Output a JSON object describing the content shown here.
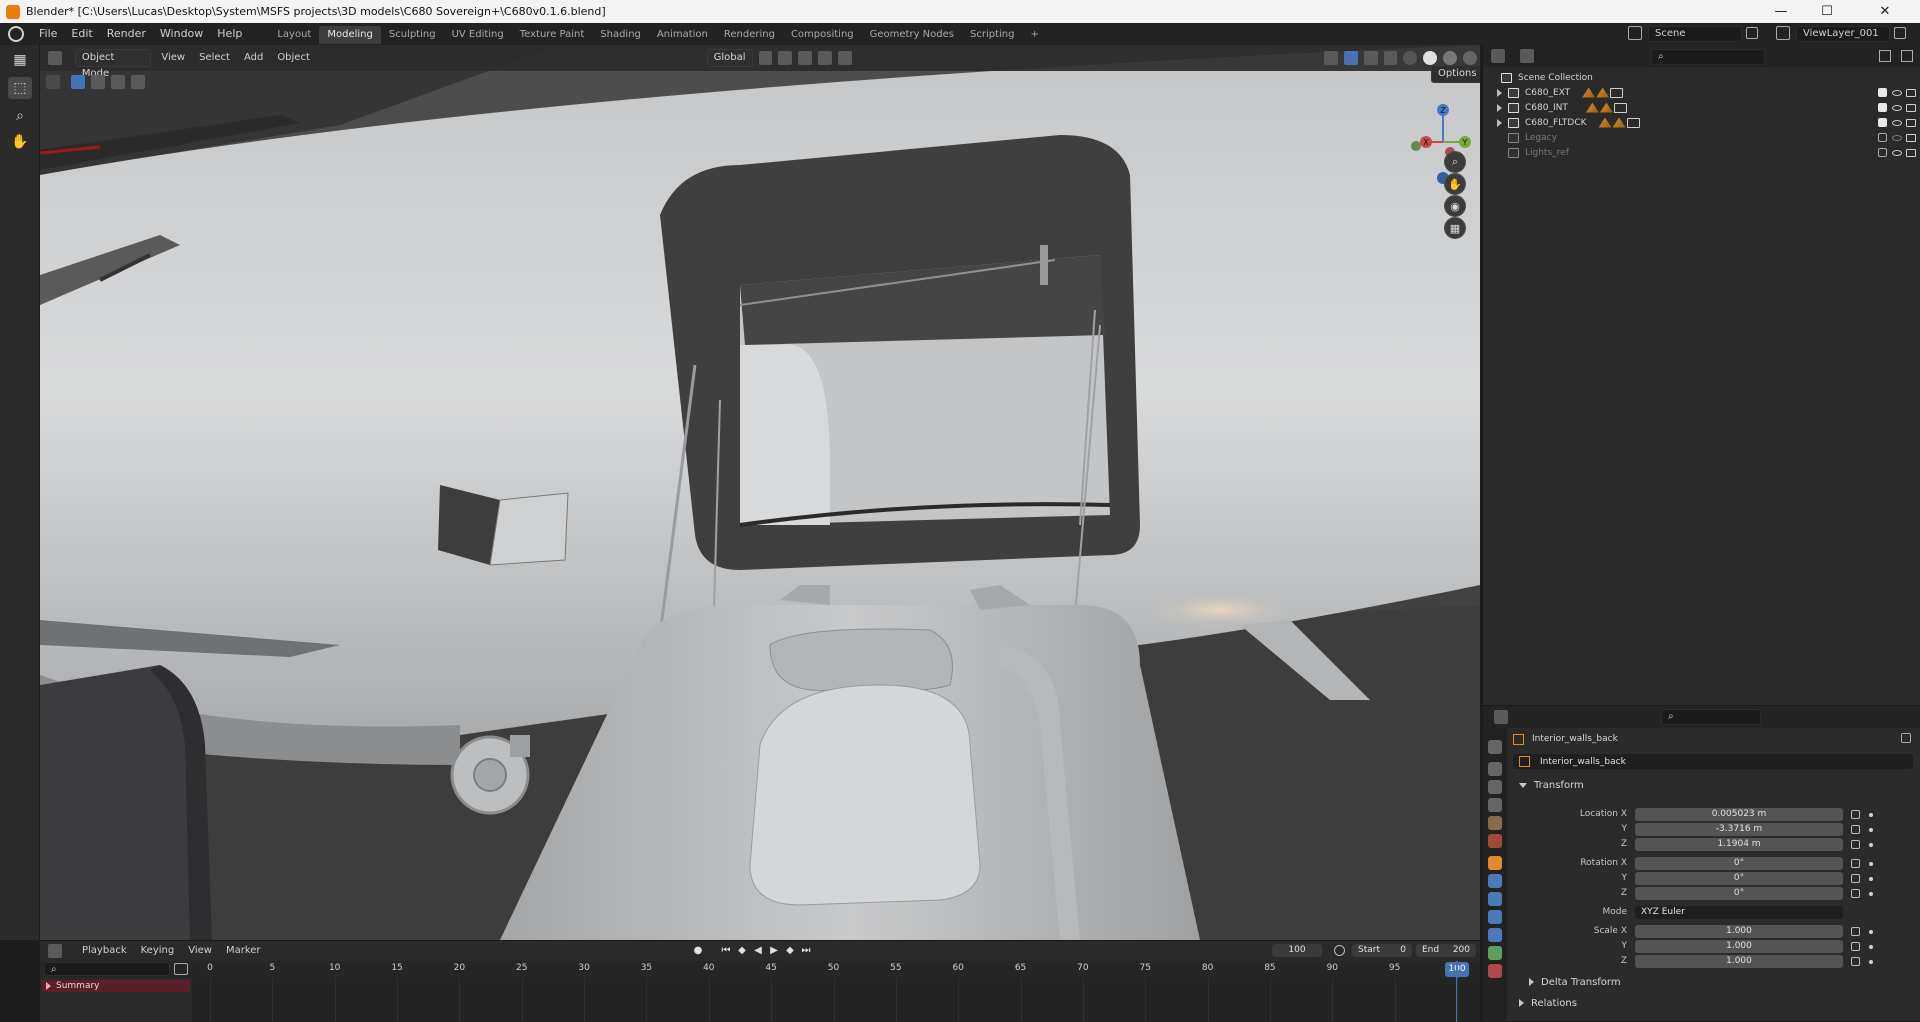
{
  "window": {
    "title": "Blender* [C:\\Users\\Lucas\\Desktop\\System\\MSFS projects\\3D models\\C680 Sovereign+\\C680v0.1.6.blend]",
    "minimize": "—",
    "maximize": "☐",
    "close": "✕"
  },
  "menu": [
    "File",
    "Edit",
    "Render",
    "Window",
    "Help"
  ],
  "workspaces": [
    "Layout",
    "Modeling",
    "Sculpting",
    "UV Editing",
    "Texture Paint",
    "Shading",
    "Animation",
    "Rendering",
    "Compositing",
    "Geometry Nodes",
    "Scripting"
  ],
  "workspace_add": "+",
  "active_workspace": "Modeling",
  "scene": {
    "name": "Scene",
    "view_layer": "ViewLayer_001"
  },
  "viewport": {
    "mode": "Object Mode",
    "menus": [
      "View",
      "Select",
      "Add",
      "Object"
    ],
    "orientation": "Global",
    "options_label": "Options",
    "gizmo": {
      "x": "X",
      "y": "Y",
      "z": "Z"
    },
    "nav": [
      "zoom-icon",
      "pan-hand-icon",
      "camera-icon",
      "grid-icon"
    ]
  },
  "outliner": {
    "root": "Scene Collection",
    "collections": [
      {
        "name": "C680_EXT",
        "dim": false,
        "expanded": false,
        "visible": true
      },
      {
        "name": "C680_INT",
        "dim": false,
        "expanded": false,
        "visible": true
      },
      {
        "name": "C680_FLTDCK",
        "dim": false,
        "expanded": false,
        "visible": true
      },
      {
        "name": "Legacy",
        "dim": true,
        "expanded": false,
        "visible": false
      },
      {
        "name": "Lights_ref",
        "dim": true,
        "expanded": false,
        "visible": false
      }
    ]
  },
  "properties": {
    "object_name": "Interior_walls_back",
    "data_name": "Interior_walls_back",
    "transform_label": "Transform",
    "location": {
      "label_x": "Location X",
      "label_y": "Y",
      "label_z": "Z",
      "x": "0.005023 m",
      "y": "-3.3716 m",
      "z": "1.1904 m"
    },
    "rotation": {
      "label_x": "Rotation X",
      "label_y": "Y",
      "label_z": "Z",
      "x": "0°",
      "y": "0°",
      "z": "0°"
    },
    "mode_label": "Mode",
    "mode_value": "XYZ Euler",
    "scale": {
      "label_x": "Scale X",
      "label_y": "Y",
      "label_z": "Z",
      "x": "1.000",
      "y": "1.000",
      "z": "1.000"
    },
    "delta_transform": "Delta Transform",
    "relations": "Relations"
  },
  "timeline": {
    "menus": [
      "Playback",
      "Keying",
      "View",
      "Marker"
    ],
    "current_frame": "100",
    "start_label": "Start",
    "start": "0",
    "end_label": "End",
    "end": "200",
    "summary_label": "Summary",
    "ticks": [
      "0",
      "5",
      "10",
      "15",
      "20",
      "25",
      "30",
      "35",
      "40",
      "45",
      "50",
      "55",
      "60",
      "65",
      "70",
      "75",
      "80",
      "85",
      "90",
      "95",
      "100"
    ],
    "playhead": "100"
  }
}
